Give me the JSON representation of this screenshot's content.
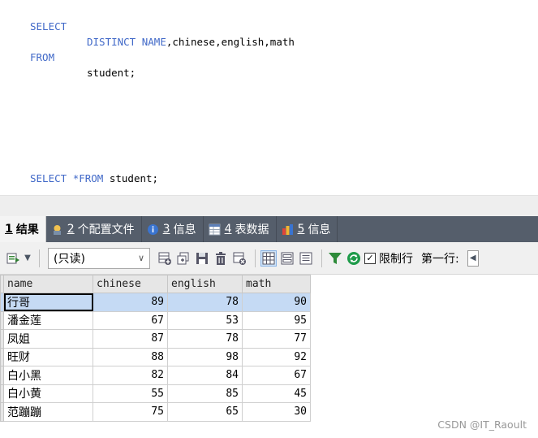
{
  "editor": {
    "query1": {
      "select_kw": "SELECT",
      "distinct_kw": "DISTINCT",
      "name_kw": "NAME",
      "columns_rest": ",chinese,english,math",
      "from_kw": "FROM",
      "table": "student;"
    },
    "query2": {
      "select_kw": "SELECT",
      "star": "*",
      "from_kw": "FROM",
      "table": " student;"
    }
  },
  "tabs": [
    {
      "num": "1",
      "label": "结果",
      "icon": "table-result-icon"
    },
    {
      "num": "2",
      "label": "个配置文件",
      "icon": "profile-icon"
    },
    {
      "num": "3",
      "label": "信息",
      "icon": "info-icon"
    },
    {
      "num": "4",
      "label": "表数据",
      "icon": "table-data-icon"
    },
    {
      "num": "5",
      "label": "信息",
      "icon": "info-color-icon"
    }
  ],
  "toolbar": {
    "mode_select": "(只读)",
    "limit_label": "限制行",
    "first_row_label": "第一行:",
    "limit_checked": true
  },
  "grid": {
    "columns": [
      "name",
      "chinese",
      "english",
      "math"
    ],
    "rows": [
      [
        "行哥",
        "89",
        "78",
        "90"
      ],
      [
        "潘金莲",
        "67",
        "53",
        "95"
      ],
      [
        "凤姐",
        "87",
        "78",
        "77"
      ],
      [
        "旺财",
        "88",
        "98",
        "92"
      ],
      [
        "白小黑",
        "82",
        "84",
        "67"
      ],
      [
        "白小黄",
        "55",
        "85",
        "45"
      ],
      [
        "范蹦蹦",
        "75",
        "65",
        "30"
      ]
    ]
  },
  "watermark": "CSDN @IT_Raoult"
}
